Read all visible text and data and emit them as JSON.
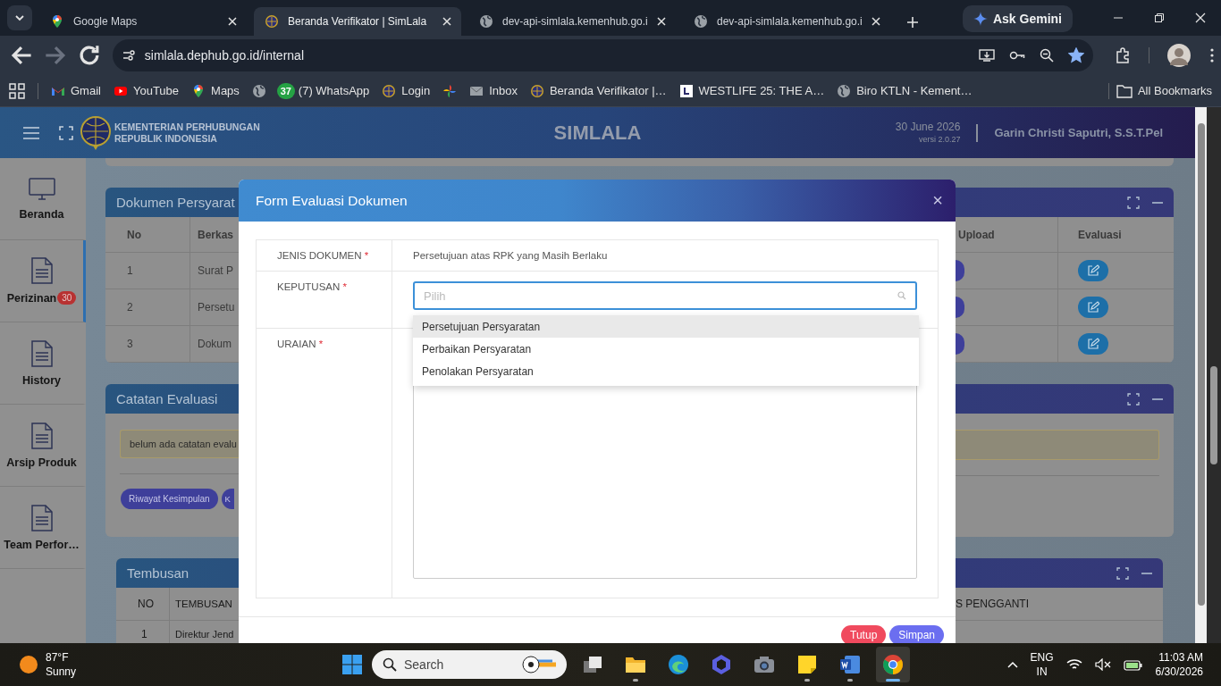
{
  "browser": {
    "tabs": [
      {
        "title": "Google Maps",
        "kind": "maps",
        "selected": false
      },
      {
        "title": "Beranda Verifikator | SimLala",
        "kind": "emblem",
        "selected": true
      },
      {
        "title": "dev-api-simlala.kemenhub.go.i",
        "kind": "globe",
        "selected": false
      },
      {
        "title": "dev-api-simlala.kemenhub.go.i",
        "kind": "globe",
        "selected": false
      }
    ],
    "gemini": "Ask Gemini",
    "nav": [
      {
        "kind": "back",
        "disabled": false
      },
      {
        "kind": "forward",
        "disabled": true
      },
      {
        "kind": "reload",
        "disabled": false
      }
    ],
    "address": "simlala.dephub.go.id/internal",
    "bookmarked": true,
    "bookmarks": [
      {
        "kind": "gmail",
        "label": "Gmail"
      },
      {
        "kind": "youtube",
        "label": "YouTube"
      },
      {
        "kind": "maps",
        "label": "Maps"
      },
      {
        "kind": "globe"
      },
      {
        "kind": "whatsapp",
        "badge": "37",
        "label": "(7) WhatsApp"
      },
      {
        "kind": "emblem",
        "label": "Login"
      },
      {
        "kind": "pinwheel"
      },
      {
        "kind": "mail",
        "label": "Inbox"
      },
      {
        "kind": "emblem",
        "label": "Beranda Verifikator |…"
      },
      {
        "kind": "letter",
        "label": "WESTLIFE 25: THE A…"
      },
      {
        "kind": "globe",
        "label": "Biro KTLN - Kement…"
      }
    ],
    "all_bookmarks": "All Bookmarks"
  },
  "header": {
    "org": [
      "KEMENTERIAN PERHUBUNGAN",
      "REPUBLIK INDONESIA"
    ],
    "app_name": "SIMLALA",
    "date": "30 June 2026",
    "version": "versi 2.0.27",
    "user": "Garin Christi Saputri, S.S.T.Pel"
  },
  "sidebar": {
    "items": [
      {
        "kind": "monitor",
        "label": "Beranda",
        "selected": false
      },
      {
        "kind": "document",
        "label": "Perizinan",
        "badge": "30",
        "selected": true
      },
      {
        "kind": "document",
        "label": "History",
        "selected": false
      },
      {
        "kind": "document",
        "label": "Arsip Produk",
        "selected": false
      },
      {
        "kind": "document",
        "label": "Team Perfor…",
        "selected": false
      }
    ]
  },
  "documents_panel": {
    "title": "Dokumen Persyarat",
    "columns": [
      "No",
      "Berkas",
      "Upload",
      "Evaluasi"
    ],
    "rows": [
      {
        "no": "1",
        "berkas": "Surat P"
      },
      {
        "no": "2",
        "berkas": "Persetu"
      },
      {
        "no": "3",
        "berkas": "Dokum"
      }
    ]
  },
  "notes_panel": {
    "title": "Catatan Evaluasi",
    "alert": "belum ada catatan evalu",
    "buttons": [
      "Riwayat Kesimpulan",
      "K"
    ]
  },
  "cc_panel": {
    "title": "Tembusan",
    "columns": [
      "NO",
      "TEMBUSAN",
      "S PENGGANTI"
    ],
    "rows": [
      {
        "no": "1",
        "tembusan": "Direktur Jend"
      }
    ]
  },
  "modal": {
    "title": "Form Evaluasi Dokumen",
    "close": "×",
    "fields": [
      {
        "kind": "text",
        "label": "JENIS DOKUMEN",
        "required_mark": "*",
        "value": "Persetujuan atas RPK yang Masih Berlaku"
      },
      {
        "kind": "select",
        "label": "KEPUTUSAN",
        "required_mark": "*",
        "placeholder": "Pilih",
        "expanded": true,
        "options": [
          {
            "label": "Persetujuan Persyaratan",
            "hovered": true
          },
          {
            "label": "Perbaikan Persyaratan",
            "hovered": false
          },
          {
            "label": "Penolakan Persyaratan",
            "hovered": false
          }
        ]
      },
      {
        "kind": "textarea",
        "label": "URAIAN",
        "required_mark": "*"
      }
    ],
    "buttons": [
      {
        "kind": "danger",
        "label": "Tutup"
      },
      {
        "kind": "primary",
        "label": "Simpan"
      }
    ]
  },
  "taskbar": {
    "weather": {
      "temp": "87°F",
      "condition": "Sunny"
    },
    "search_placeholder": "Search",
    "apps": [
      {
        "kind": "task-view",
        "running": false,
        "active": false
      },
      {
        "kind": "folder",
        "running": true,
        "active": false
      },
      {
        "kind": "edge",
        "running": false,
        "active": false
      },
      {
        "kind": "copilot",
        "running": false,
        "active": false
      },
      {
        "kind": "camera",
        "running": false,
        "active": false
      },
      {
        "kind": "notes",
        "running": true,
        "active": false
      },
      {
        "kind": "word",
        "running": true,
        "active": false
      },
      {
        "kind": "chrome",
        "running": true,
        "active": true
      }
    ],
    "language": [
      "ENG",
      "IN"
    ],
    "time": "11:03 AM",
    "date": "6/30/2026"
  }
}
